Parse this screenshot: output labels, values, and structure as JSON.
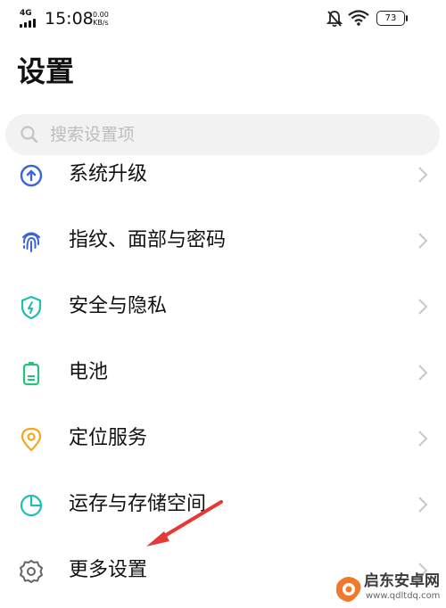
{
  "status_bar": {
    "network": "4G",
    "time": "15:08",
    "speed_value": "0.00",
    "speed_unit": "KB/s",
    "battery": "73"
  },
  "page": {
    "title": "设置"
  },
  "search": {
    "placeholder": "搜索设置项"
  },
  "settings": {
    "items": [
      {
        "label": "系统升级",
        "icon": "upgrade-icon",
        "color": "#3c63d8"
      },
      {
        "label": "指纹、面部与密码",
        "icon": "fingerprint-icon",
        "color": "#3c63d8"
      },
      {
        "label": "安全与隐私",
        "icon": "shield-icon",
        "color": "#1fbfb0"
      },
      {
        "label": "电池",
        "icon": "battery-icon",
        "color": "#24c27d"
      },
      {
        "label": "定位服务",
        "icon": "location-icon",
        "color": "#f5a623"
      },
      {
        "label": "运存与存储空间",
        "icon": "storage-icon",
        "color": "#1fbfb0"
      },
      {
        "label": "更多设置",
        "icon": "gear-icon",
        "color": "#666666"
      }
    ]
  },
  "annotation": {
    "color": "#e53935"
  },
  "watermark": {
    "logo_text": "启东安卓网",
    "url": "www.qdltdq.com"
  }
}
